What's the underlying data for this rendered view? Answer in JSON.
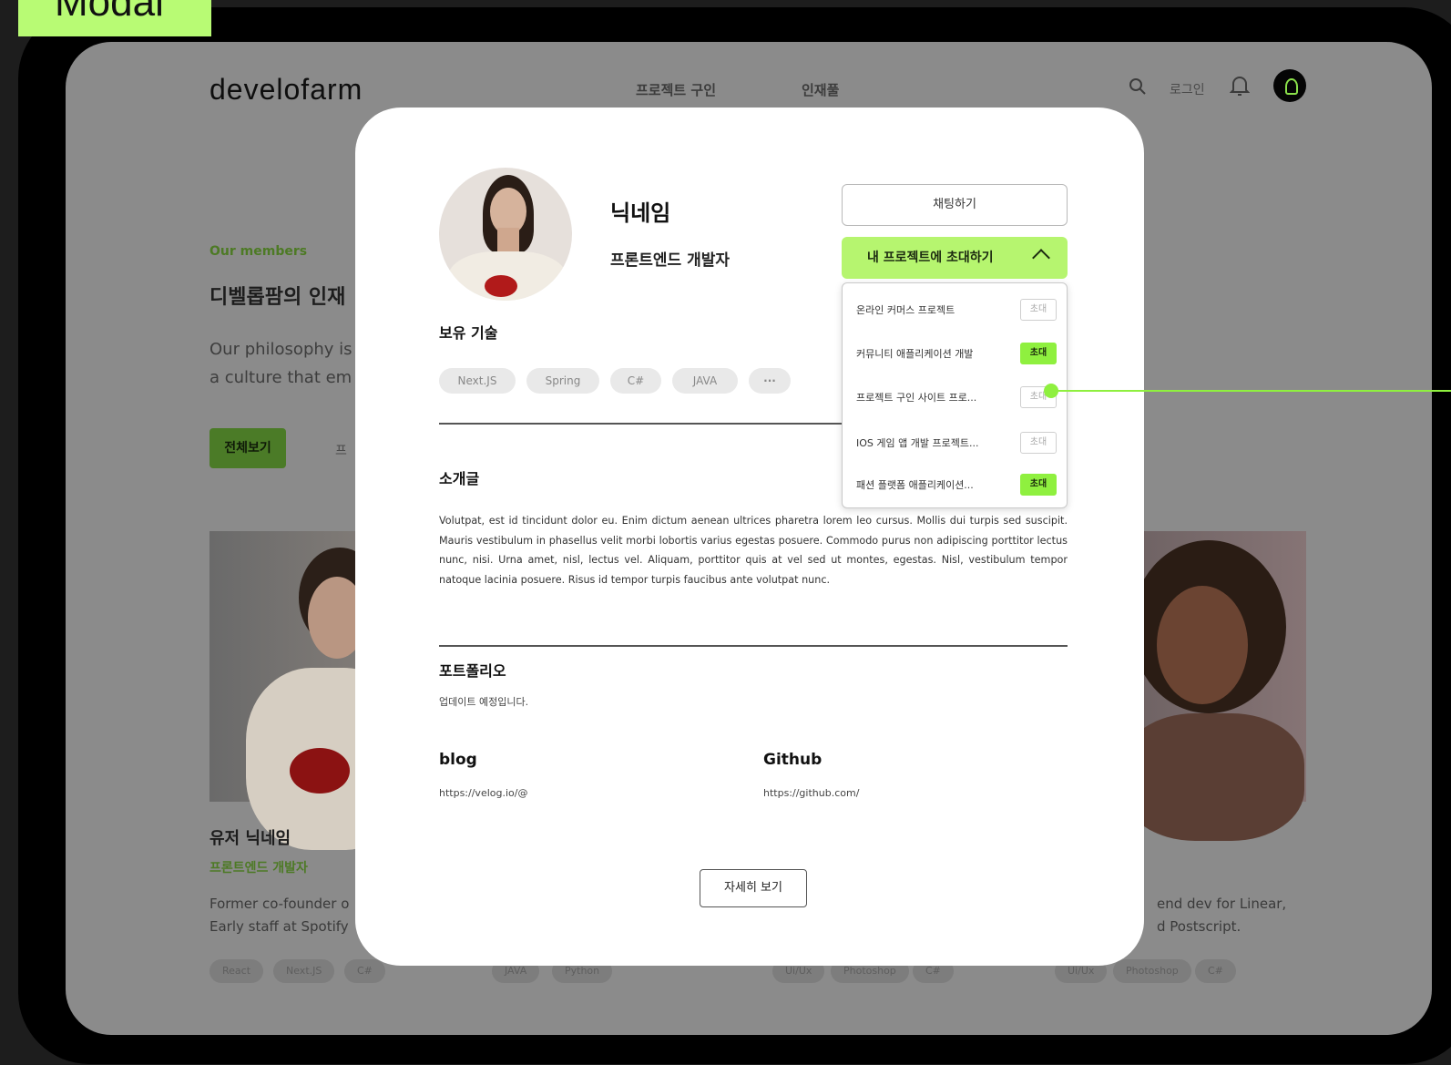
{
  "frame_label": "Modal",
  "app": {
    "logo": "develofarm",
    "nav": [
      "프로젝트 구인",
      "인재풀"
    ],
    "login": "로그인"
  },
  "background": {
    "kicker": "Our members",
    "title": "디벨롭팜의 인재",
    "desc_line1": "Our philosophy is",
    "desc_line2": "a culture that em",
    "all_button": "전체보기",
    "filter_button": "프",
    "card_left": {
      "name": "유저 닉네임",
      "role": "프론트엔드 개발자",
      "desc_line1": "Former co-founder o",
      "desc_line2": "Early staff at Spotify",
      "chips": [
        "React",
        "Next.JS",
        "C#"
      ]
    },
    "card_middle_chips": [
      "JAVA",
      "Python"
    ],
    "card_center_chips": [
      "Ui/Ux",
      "Photoshop",
      "C#"
    ],
    "card_right": {
      "desc_line1": "end dev for Linear,",
      "desc_line2": "d Postscript.",
      "chips": [
        "Ui/Ux",
        "Photoshop",
        "C#"
      ]
    }
  },
  "modal": {
    "nickname": "닉네임",
    "job": "프론트엔드 개발자",
    "chat_button": "채팅하기",
    "invite_button": "내 프로젝트에 초대하기",
    "projects": [
      {
        "name": "온라인 커머스 프로젝트",
        "action": "초대",
        "active": false
      },
      {
        "name": "커뮤니티 애플리케이션 개발",
        "action": "초대",
        "active": true
      },
      {
        "name": "프로젝트 구인 사이트 프로...",
        "action": "초대",
        "active": false
      },
      {
        "name": "IOS 게임 앱 개발 프로젝트...",
        "action": "초대",
        "active": false
      },
      {
        "name": "패션 플랫폼 애플리케이션...",
        "action": "초대",
        "active": true
      }
    ],
    "skills_title": "보유 기술",
    "skills": [
      "Next.JS",
      "Spring",
      "C#",
      "JAVA",
      "···"
    ],
    "intro_title": "소개글",
    "intro_text": "Volutpat, est id tincidunt dolor eu. Enim dictum aenean ultrices pharetra lorem leo cursus. Mollis dui turpis sed suscipit. Mauris vestibulum in phasellus velit morbi lobortis varius egestas posuere. Commodo purus non adipiscing porttitor lectus nunc, nisi. Urna amet, nisl, lectus vel. Aliquam, porttitor quis at vel sed ut montes, egestas. Nisl, vestibulum tempor natoque lacinia posuere. Risus id tempor turpis faucibus ante volutpat nunc.",
    "portfolio_title": "포트폴리오",
    "portfolio_text": "업데이트 예정입니다.",
    "blog_title": "blog",
    "blog_url": "https://velog.io/@",
    "github_title": "Github",
    "github_url": "https://github.com/",
    "detail_button": "자세히 보기"
  },
  "colors": {
    "accent": "#b6f56f",
    "accent_strong": "#8ff03f"
  }
}
